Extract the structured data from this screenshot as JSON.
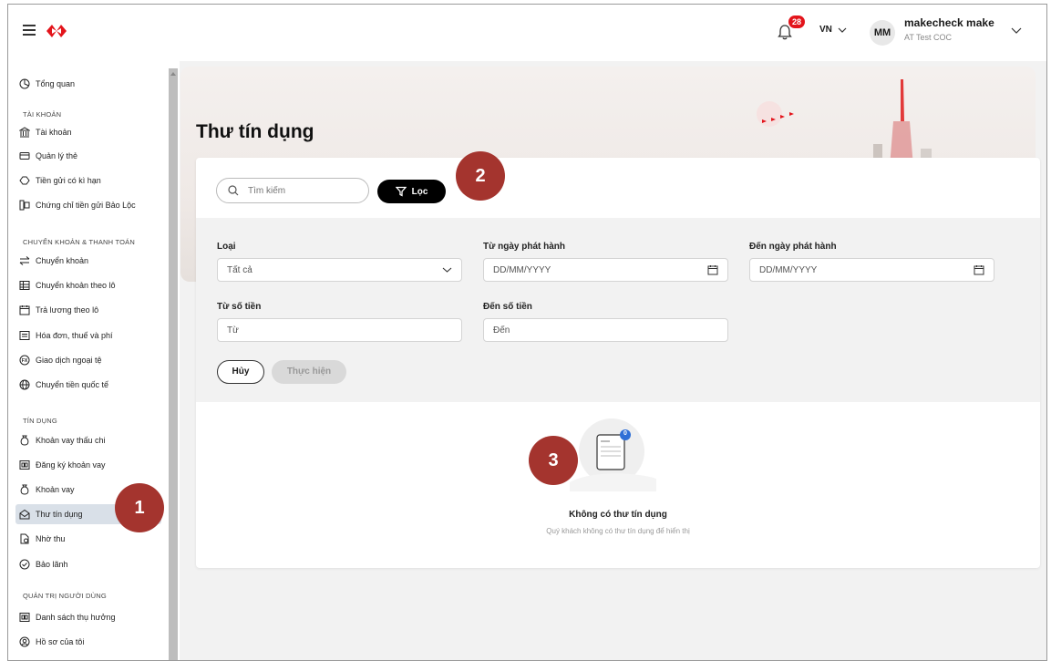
{
  "header": {
    "notification_count": "28",
    "language": "VN",
    "avatar_initials": "MM",
    "user_name": "makecheck make",
    "user_org": "AT Test COC"
  },
  "sidebar": {
    "overview": "Tổng quan",
    "section_account": "TÀI KHOẢN",
    "accounts": "Tài khoản",
    "cards": "Quản lý thẻ",
    "term_deposit": "Tiền gửi có kì hạn",
    "bao_loc_cert": "Chứng chỉ tiền gửi Bảo Lộc",
    "section_transfer": "CHUYỂN KHOẢN & THANH TOÁN",
    "transfer": "Chuyển khoản",
    "batch_transfer": "Chuyển khoản theo lô",
    "batch_salary": "Trả lương theo lô",
    "bills": "Hóa đơn, thuế và phí",
    "fx": "Giao dịch ngoại tệ",
    "intl_transfer": "Chuyển tiền quốc tế",
    "section_credit": "TÍN DỤNG",
    "overdraft": "Khoản vay thấu chi",
    "loan_register": "Đăng ký khoản vay",
    "loans": "Khoản vay",
    "letters_of_credit": "Thư tín dụng",
    "collections": "Nhờ thu",
    "guarantees": "Bảo lãnh",
    "section_user_admin": "QUẢN TRỊ NGƯỜI DÙNG",
    "beneficiaries": "Danh sách thụ hưởng",
    "profile": "Hồ sơ của tôi"
  },
  "main": {
    "title": "Thư tín dụng",
    "search_placeholder": "Tìm kiếm",
    "filter_label": "Lọc",
    "filters": {
      "type_label": "Loại",
      "type_value": "Tất cả",
      "from_issue_date_label": "Từ ngày phát hành",
      "from_issue_date_placeholder": "DD/MM/YYYY",
      "to_issue_date_label": "Đến ngày phát hành",
      "to_issue_date_placeholder": "DD/MM/YYYY",
      "from_amount_label": "Từ số tiền",
      "from_amount_placeholder": "Từ",
      "to_amount_label": "Đến số tiền",
      "to_amount_placeholder": "Đến",
      "cancel_label": "Hủy",
      "submit_label": "Thực hiện"
    },
    "empty": {
      "count": "0",
      "title": "Không có thư tín dụng",
      "subtitle": "Quý khách không có thư tín dụng để hiển thị"
    }
  },
  "markers": [
    "1",
    "2",
    "3"
  ],
  "colors": {
    "brand_red": "#e3141b",
    "marker": "#a4342e",
    "active_item": "#d9e0e8"
  }
}
